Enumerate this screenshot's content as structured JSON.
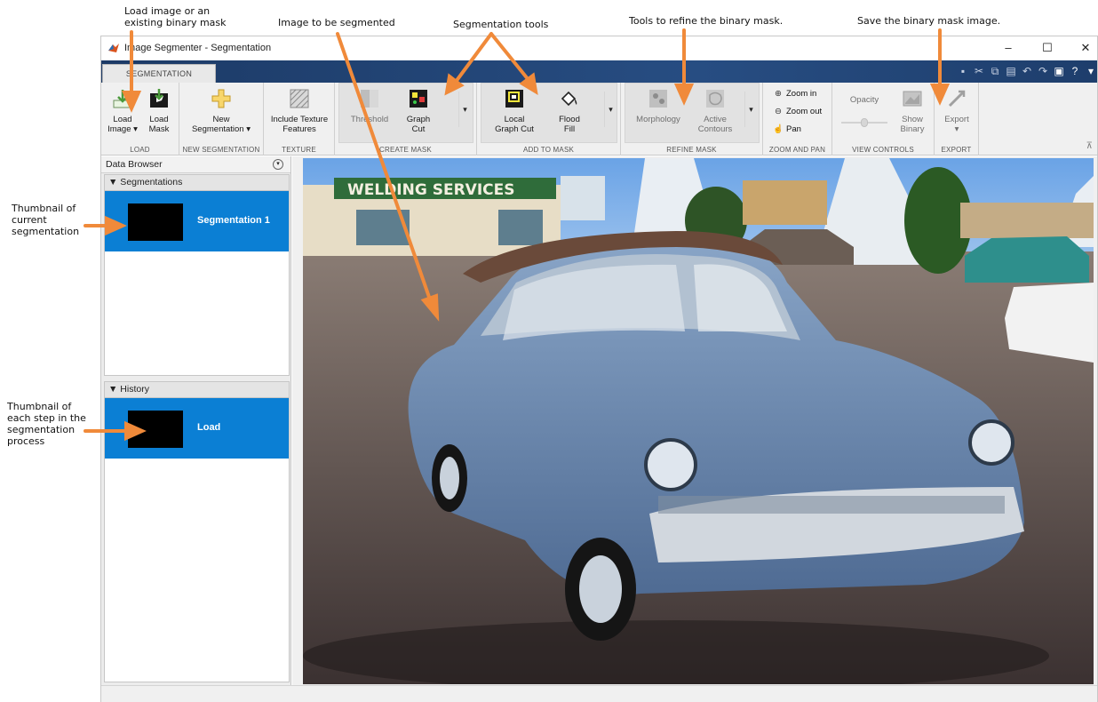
{
  "annotations": {
    "load": "Load image or an\nexisting binary mask",
    "image": "Image to be segmented",
    "seg_tools": "Segmentation tools",
    "refine": "Tools to refine the binary mask.",
    "save": "Save the binary mask image.",
    "thumb_current": "Thumbnail of\ncurrent\nsegmentation",
    "thumb_history": "Thumbnail of\neach step in the\nsegmentation\nprocess"
  },
  "window": {
    "title": "Image Segmenter - Segmentation",
    "min": "–",
    "max": "☐",
    "close": "✕"
  },
  "tab": {
    "label": "SEGMENTATION"
  },
  "toolstrip": {
    "load": {
      "label": "LOAD",
      "load_image": "Load\nImage ▾",
      "load_mask": "Load\nMask"
    },
    "new_seg": {
      "label": "NEW SEGMENTATION",
      "button": "New\nSegmentation ▾"
    },
    "texture": {
      "label": "TEXTURE",
      "button": "Include Texture\nFeatures"
    },
    "create": {
      "label": "CREATE MASK",
      "threshold": "Threshold",
      "graph_cut": "Graph\nCut"
    },
    "add": {
      "label": "ADD TO MASK",
      "local_graph_cut": "Local\nGraph Cut",
      "flood_fill": "Flood\nFill"
    },
    "refine": {
      "label": "REFINE MASK",
      "morphology": "Morphology",
      "active_contours": "Active\nContours"
    },
    "zoom": {
      "label": "ZOOM AND PAN",
      "zoom_in": "Zoom in",
      "zoom_out": "Zoom out",
      "pan": "Pan"
    },
    "view": {
      "label": "VIEW CONTROLS",
      "opacity": "Opacity",
      "show_binary": "Show\nBinary"
    },
    "export": {
      "label": "EXPORT",
      "button": "Export"
    },
    "dropdown": "▾"
  },
  "browser": {
    "title": "Data Browser",
    "segmentations_header": "▼ Segmentations",
    "segmentation_item": "Segmentation 1",
    "history_header": "▼ History",
    "history_item": "Load"
  },
  "photo": {
    "sign": "WELDING SERVICES"
  },
  "colors": {
    "accent": "#0b7fd4",
    "arrow": "#f08a3a",
    "tabstrip": "#274d82"
  }
}
